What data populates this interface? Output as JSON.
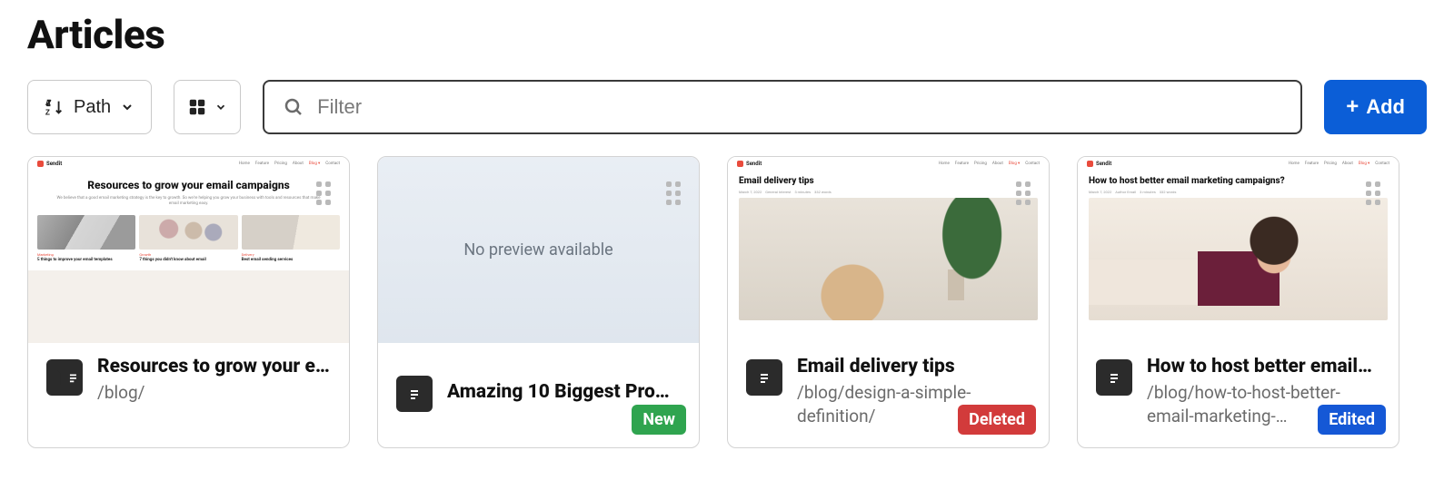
{
  "page": {
    "title": "Articles"
  },
  "toolbar": {
    "sort_label": "Path",
    "filter_placeholder": "Filter",
    "add_label": "Add"
  },
  "cards": [
    {
      "title": "Resources to grow your e…",
      "path": "/blog/",
      "status": null,
      "preview_kind": "resources",
      "preview_title": "Resources to grow your email campaigns",
      "preview_sub": "We believe that a good email marketing strategy is the key to growth. So we're helping you grow your business with tools and resources that make email marketing easy.",
      "thumbs": [
        {
          "tag": "Marketing",
          "cap": "5 things to improve your email templates"
        },
        {
          "tag": "Growth",
          "cap": "7 things you didn't know about email"
        },
        {
          "tag": "Delivery",
          "cap": "Best email sending services"
        }
      ]
    },
    {
      "title": "Amazing 10 Biggest Pro…",
      "path": null,
      "status": "New",
      "preview_kind": "none",
      "no_preview_text": "No preview available"
    },
    {
      "title": "Email delivery tips",
      "path": "/blog/design-a-simple-definition/",
      "status": "Deleted",
      "preview_kind": "article",
      "preview_heading": "Email delivery tips"
    },
    {
      "title": "How to host better email…",
      "path": "/blog/how-to-host-better-email-marketing-…",
      "status": "Edited",
      "preview_kind": "article",
      "preview_heading": "How to host better email marketing campaigns?"
    }
  ],
  "preview_common": {
    "brand": "Sendit",
    "nav": [
      "Home",
      "Feature",
      "Pricing",
      "About",
      "Blog ▾",
      "Contact"
    ],
    "meta_items": [
      "March 7, 2022",
      "General Interest",
      "3 minutes",
      "332 words"
    ]
  }
}
